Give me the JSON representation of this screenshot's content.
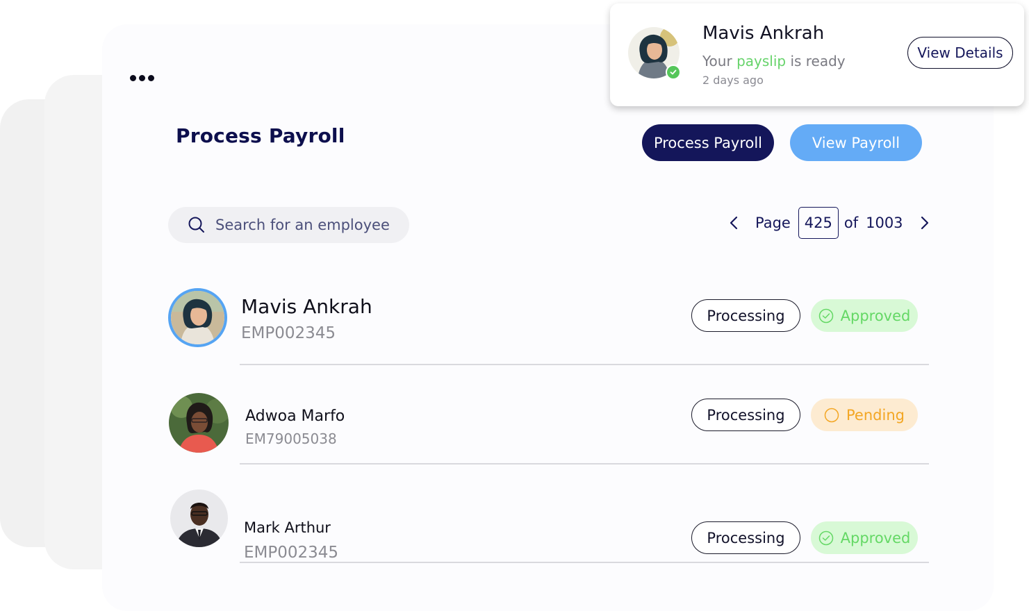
{
  "page": {
    "title": "Process Payroll",
    "menu_icon": "more-dots-icon"
  },
  "actions": {
    "process_payroll_label": "Process Payroll",
    "view_payroll_label": "View Payroll",
    "colors": {
      "primary": "#14165a",
      "secondary": "#64abf6"
    }
  },
  "search": {
    "placeholder": "Search for an employee",
    "icon": "search-icon"
  },
  "pagination": {
    "page_label": "Page",
    "current_page": "425",
    "of_label": "of",
    "total_pages": "1003",
    "prev_icon": "chevron-left-icon",
    "next_icon": "chevron-right-icon"
  },
  "employees": [
    {
      "name": "Mavis Ankrah",
      "id": "EMP002345",
      "processing_label": "Processing",
      "status": "Approved",
      "status_icon": "check-circle-icon"
    },
    {
      "name": "Adwoa Marfo",
      "id": "EM79005038",
      "processing_label": "Processing",
      "status": "Pending",
      "status_icon": "circle-icon"
    },
    {
      "name": "Mark Arthur",
      "id": "EMP002345",
      "processing_label": "Processing",
      "status": "Approved",
      "status_icon": "check-circle-icon"
    }
  ],
  "notification": {
    "name": "Mavis Ankrah",
    "message_prefix": "Your",
    "message_highlight": "payslip",
    "message_suffix": "is ready",
    "time": "2 days ago",
    "button_label": "View Details",
    "badge_icon": "check-badge-icon"
  },
  "status_colors": {
    "approved_bg": "#d8f9d6",
    "approved_text": "#64d865",
    "pending_bg": "#fdebd1",
    "pending_text": "#f3a623"
  }
}
